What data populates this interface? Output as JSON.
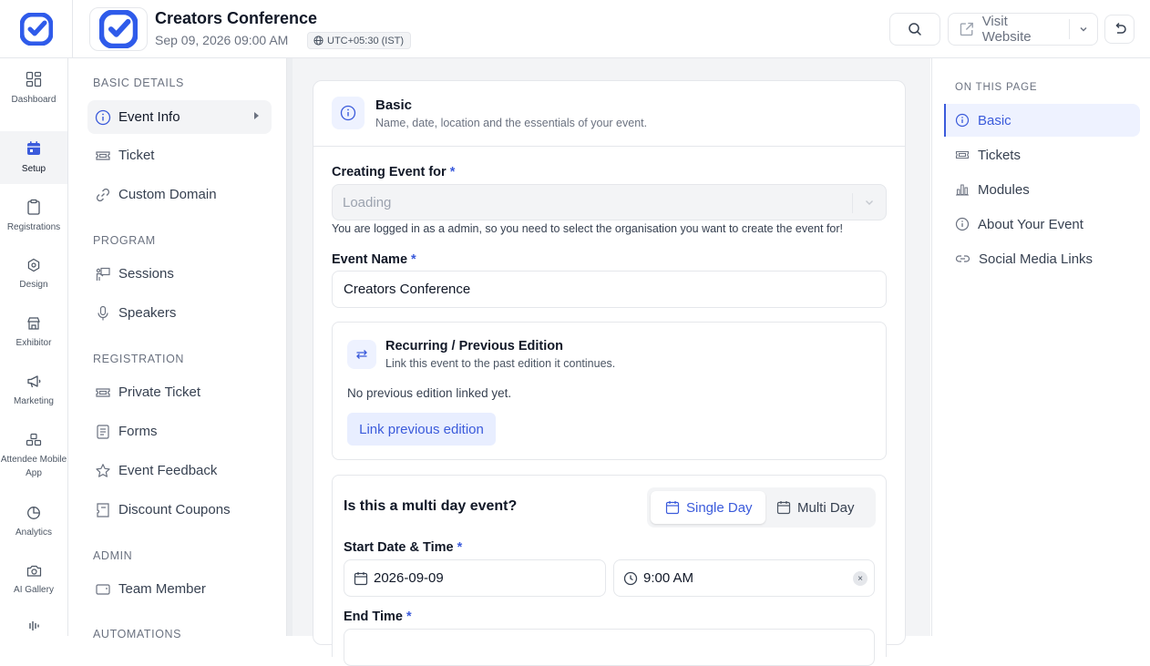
{
  "event": {
    "title": "Creators Conference",
    "datetime": "Sep 09, 2026 09:00 AM",
    "timezone": "UTC+05:30 (IST)"
  },
  "header": {
    "visit_label": "Visit Website"
  },
  "rail": {
    "items": [
      {
        "label": "Dashboard",
        "icon": "grid-icon"
      },
      {
        "label": "Setup",
        "icon": "calendar-icon",
        "active": true
      },
      {
        "label": "Registrations",
        "icon": "clipboard-icon"
      },
      {
        "label": "Design",
        "icon": "palette-icon"
      },
      {
        "label": "Exhibitor",
        "icon": "store-icon"
      },
      {
        "label": "Marketing",
        "icon": "megaphone-icon"
      },
      {
        "label": "Attendee Mobile App",
        "icon": "people-icon"
      },
      {
        "label": "Analytics",
        "icon": "pie-icon"
      },
      {
        "label": "AI Gallery",
        "icon": "camera-icon"
      }
    ]
  },
  "subnav": {
    "sections": {
      "basic": "BASIC DETAILS",
      "program": "PROGRAM",
      "registration": "REGISTRATION",
      "admin": "ADMIN",
      "automations": "AUTOMATIONS"
    },
    "items": {
      "event_info": "Event Info",
      "ticket": "Ticket",
      "custom_domain": "Custom Domain",
      "sessions": "Sessions",
      "speakers": "Speakers",
      "private_ticket": "Private Ticket",
      "forms": "Forms",
      "event_feedback": "Event Feedback",
      "discount_coupons": "Discount Coupons",
      "team_member": "Team Member"
    }
  },
  "basic": {
    "title": "Basic",
    "subtitle": "Name, date, location and the essentials of your event.",
    "creating_for_label": "Creating Event for",
    "required_mark": "*",
    "creating_for_value": "Loading",
    "creating_for_hint": "You are logged in as a admin, so you need to select the organisation you want to create the event for!",
    "event_name_label": "Event Name",
    "event_name_value": "Creators Conference"
  },
  "recurring": {
    "title": "Recurring / Previous Edition",
    "subtitle": "Link this event to the past edition it continues.",
    "empty": "No previous edition linked yet.",
    "button": "Link previous edition"
  },
  "schedule": {
    "question": "Is this a multi day event?",
    "single_day": "Single Day",
    "multi_day": "Multi Day",
    "selected": "Single Day",
    "start_label": "Start Date & Time",
    "start_date": "2026-09-09",
    "start_time": "9:00 AM",
    "end_label": "End Time"
  },
  "on_this_page": {
    "heading": "ON THIS PAGE",
    "items": [
      "Basic",
      "Tickets",
      "Modules",
      "About Your Event",
      "Social Media Links"
    ],
    "active": "Basic"
  },
  "colors": {
    "accent": "#3b5bdb",
    "brand": "#2f5bea"
  }
}
